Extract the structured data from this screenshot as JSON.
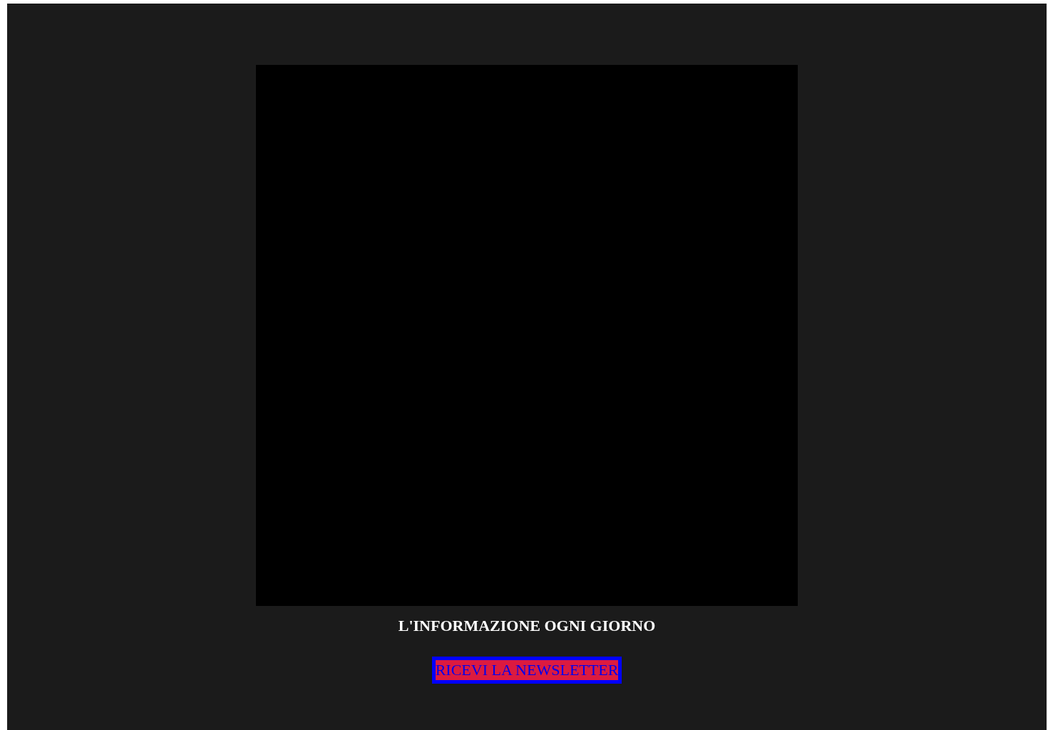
{
  "headline": "L'INFORMAZIONE OGNI GIORNO",
  "newsletter_button": {
    "label": "RICEVI LA NEWSLETTER"
  }
}
